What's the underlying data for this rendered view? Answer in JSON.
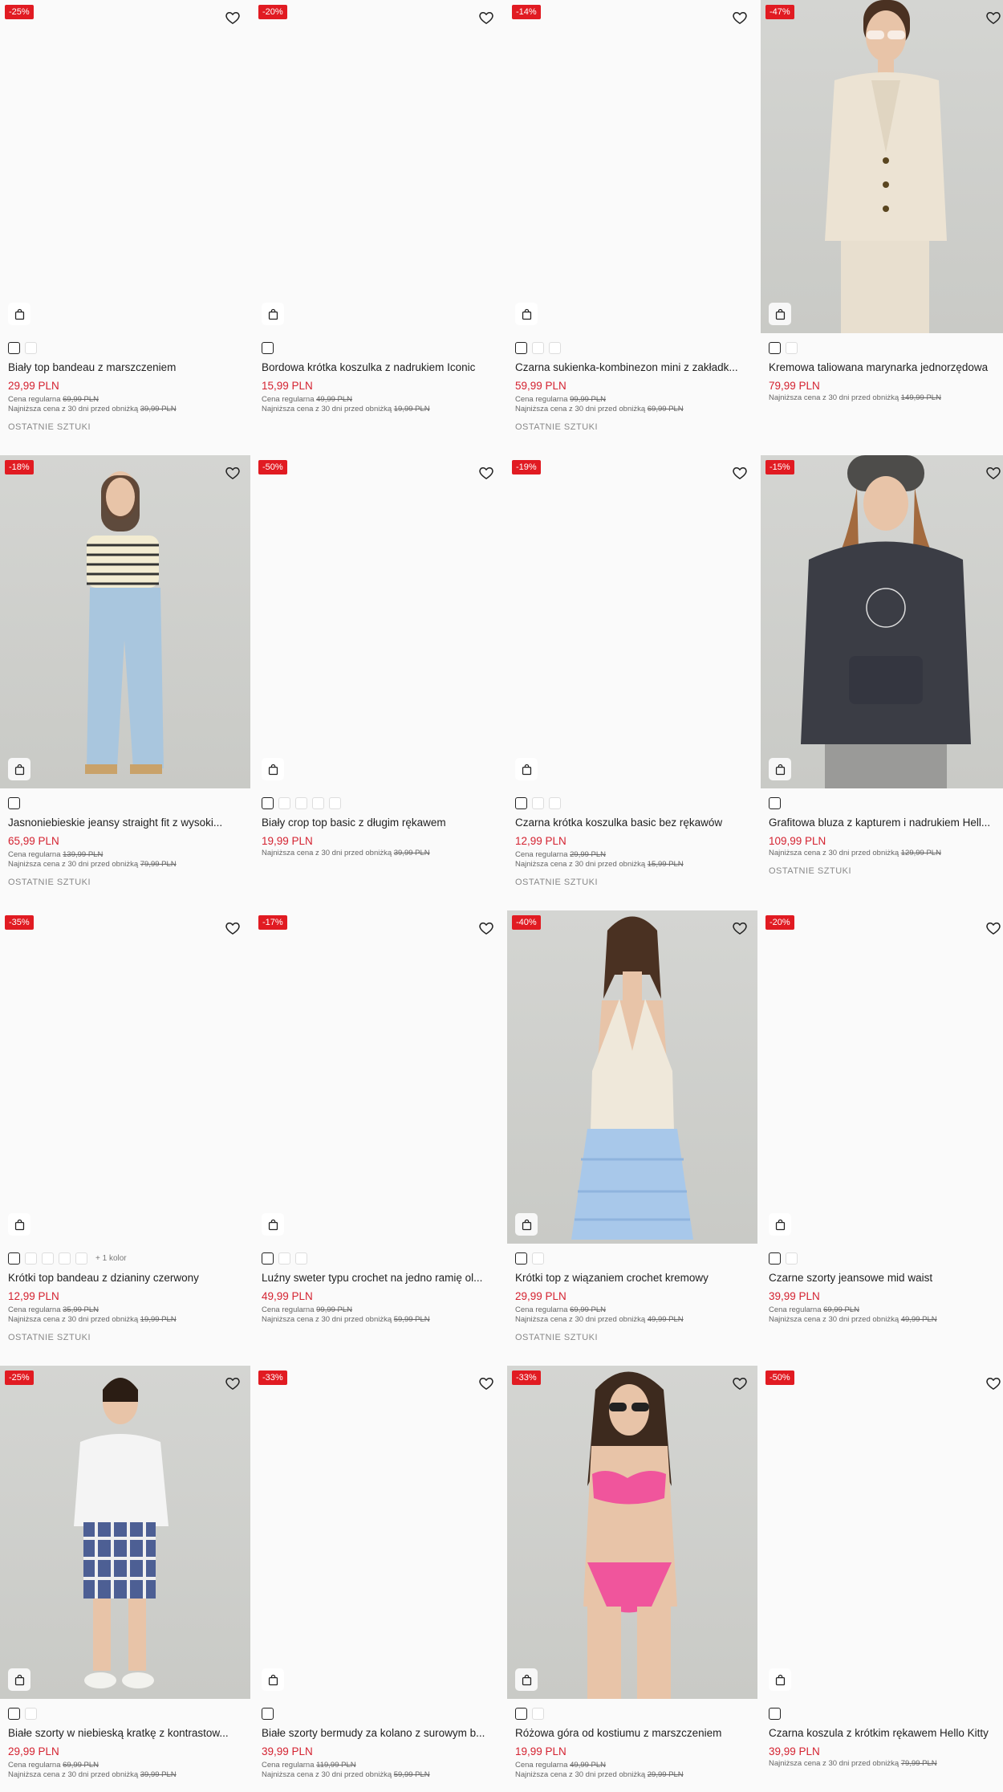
{
  "products": [
    {
      "badge": "-25%",
      "name": "Biały top bandeau z marszczeniem",
      "price": "29,99 PLN",
      "reg_label": "Cena regularna",
      "reg_price": "69,99 PLN",
      "low_label": "Najniższa cena z 30 dni przed obniżką",
      "low_price": "39,99 PLN",
      "last": "OSTATNIE SZTUKI",
      "swatches": 2
    },
    {
      "badge": "-20%",
      "name": "Bordowa krótka koszulka z nadrukiem Iconic",
      "price": "15,99 PLN",
      "reg_label": "Cena regularna",
      "reg_price": "49,99 PLN",
      "low_label": "Najniższa cena z 30 dni przed obniżką",
      "low_price": "19,99 PLN",
      "last": "",
      "swatches": 1
    },
    {
      "badge": "-14%",
      "name": "Czarna sukienka-kombinezon mini z zakładk...",
      "price": "59,99 PLN",
      "reg_label": "Cena regularna",
      "reg_price": "99,99 PLN",
      "low_label": "Najniższa cena z 30 dni przed obniżką",
      "low_price": "69,99 PLN",
      "last": "OSTATNIE SZTUKI",
      "swatches": 3
    },
    {
      "badge": "-47%",
      "name": "Kremowa taliowana marynarka jednorzędowa",
      "price": "79,99 PLN",
      "reg_label": "",
      "reg_price": "",
      "low_label": "Najniższa cena z 30 dni przed obniżką",
      "low_price": "149,99 PLN",
      "last": "",
      "swatches": 2
    },
    {
      "badge": "-18%",
      "name": "Jasnoniebieskie jeansy straight fit z wysoki...",
      "price": "65,99 PLN",
      "reg_label": "Cena regularna",
      "reg_price": "139,99 PLN",
      "low_label": "Najniższa cena z 30 dni przed obniżką",
      "low_price": "79,99 PLN",
      "last": "OSTATNIE SZTUKI",
      "swatches": 1
    },
    {
      "badge": "-50%",
      "name": "Biały crop top basic z długim rękawem",
      "price": "19,99 PLN",
      "reg_label": "",
      "reg_price": "",
      "low_label": "Najniższa cena z 30 dni przed obniżką",
      "low_price": "39,99 PLN",
      "last": "",
      "swatches": 5
    },
    {
      "badge": "-19%",
      "name": "Czarna krótka koszulka basic bez rękawów",
      "price": "12,99 PLN",
      "reg_label": "Cena regularna",
      "reg_price": "29,99 PLN",
      "low_label": "Najniższa cena z 30 dni przed obniżką",
      "low_price": "15,99 PLN",
      "last": "OSTATNIE SZTUKI",
      "swatches": 3
    },
    {
      "badge": "-15%",
      "name": "Grafitowa bluza z kapturem i nadrukiem Hell...",
      "price": "109,99 PLN",
      "reg_label": "",
      "reg_price": "",
      "low_label": "Najniższa cena z 30 dni przed obniżką",
      "low_price": "129,99 PLN",
      "last": "OSTATNIE SZTUKI",
      "swatches": 1
    },
    {
      "badge": "-35%",
      "name": "Krótki top bandeau z dzianiny czerwony",
      "price": "12,99 PLN",
      "reg_label": "Cena regularna",
      "reg_price": "35,99 PLN",
      "low_label": "Najniższa cena z 30 dni przed obniżką",
      "low_price": "19,99 PLN",
      "last": "OSTATNIE SZTUKI",
      "swatches": 5,
      "more": "+ 1 kolor"
    },
    {
      "badge": "-17%",
      "name": "Luźny sweter typu crochet na jedno ramię ol...",
      "price": "49,99 PLN",
      "reg_label": "Cena regularna",
      "reg_price": "99,99 PLN",
      "low_label": "Najniższa cena z 30 dni przed obniżką",
      "low_price": "59,99 PLN",
      "last": "",
      "swatches": 3
    },
    {
      "badge": "-40%",
      "name": "Krótki top z wiązaniem crochet kremowy",
      "price": "29,99 PLN",
      "reg_label": "Cena regularna",
      "reg_price": "69,99 PLN",
      "low_label": "Najniższa cena z 30 dni przed obniżką",
      "low_price": "49,99 PLN",
      "last": "OSTATNIE SZTUKI",
      "swatches": 2
    },
    {
      "badge": "-20%",
      "name": "Czarne szorty jeansowe mid waist",
      "price": "39,99 PLN",
      "reg_label": "Cena regularna",
      "reg_price": "69,99 PLN",
      "low_label": "Najniższa cena z 30 dni przed obniżką",
      "low_price": "49,99 PLN",
      "last": "",
      "swatches": 2
    },
    {
      "badge": "-25%",
      "name": "Białe szorty w niebieską kratkę z kontrastow...",
      "price": "29,99 PLN",
      "reg_label": "Cena regularna",
      "reg_price": "69,99 PLN",
      "low_label": "Najniższa cena z 30 dni przed obniżką",
      "low_price": "39,99 PLN",
      "last": "",
      "swatches": 2
    },
    {
      "badge": "-33%",
      "name": "Białe szorty bermudy za kolano z surowym b...",
      "price": "39,99 PLN",
      "reg_label": "Cena regularna",
      "reg_price": "119,99 PLN",
      "low_label": "Najniższa cena z 30 dni przed obniżką",
      "low_price": "59,99 PLN",
      "last": "",
      "swatches": 1
    },
    {
      "badge": "-33%",
      "name": "Różowa góra od kostiumu z marszczeniem",
      "price": "19,99 PLN",
      "reg_label": "Cena regularna",
      "reg_price": "49,99 PLN",
      "low_label": "Najniższa cena z 30 dni przed obniżką",
      "low_price": "29,99 PLN",
      "last": "",
      "swatches": 2
    },
    {
      "badge": "-50%",
      "name": "Czarna koszula z krótkim rękawem Hello Kitty",
      "price": "39,99 PLN",
      "reg_label": "",
      "reg_price": "",
      "low_label": "Najniższa cena z 30 dni przed obniżką",
      "low_price": "79,99 PLN",
      "last": "",
      "swatches": 1
    }
  ],
  "icons": {
    "wishlist": "heart-icon",
    "add_to_cart": "shopping-bag-icon"
  },
  "colors": {
    "badge": "#e11b22",
    "price": "#d42230",
    "text": "#222222",
    "muted": "#888888"
  }
}
